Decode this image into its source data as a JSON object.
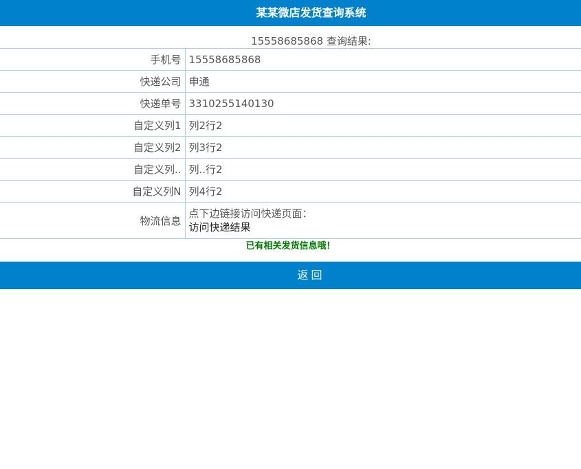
{
  "header": {
    "title": "某某微店发货查询系统"
  },
  "summary": {
    "phone": "15558685868",
    "suffix": "查询结果:"
  },
  "rows": [
    {
      "label": "手机号",
      "value": "15558685868"
    },
    {
      "label": "快递公司",
      "value": "申通"
    },
    {
      "label": "快递单号",
      "value": "3310255140130"
    },
    {
      "label": "自定义列1",
      "value": "列2行2"
    },
    {
      "label": "自定义列2",
      "value": "列3行2"
    },
    {
      "label": "自定义列..",
      "value": "列..行2"
    },
    {
      "label": "自定义列N",
      "value": "列4行2"
    }
  ],
  "logistics": {
    "label": "物流信息",
    "text": "点下边链接访问快递页面：",
    "link": "访问快递结果"
  },
  "notice": "已有相关发货信息哦！",
  "back_button": "返回",
  "colors": {
    "brand": "#0081cc",
    "notice": "#008000",
    "border": "#a8cfe0"
  }
}
